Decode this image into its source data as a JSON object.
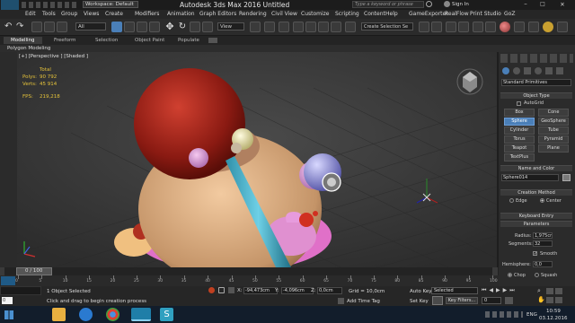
{
  "window": {
    "title": "Autodesk 3ds Max 2016    Untitled",
    "workspace": "Workspace: Default",
    "search_placeholder": "Type a keyword or phrase",
    "sign_in": "Sign In"
  },
  "menu": [
    "Edit",
    "Tools",
    "Group",
    "Views",
    "Create",
    "Modifiers",
    "Animation",
    "Graph Editors",
    "Rendering",
    "Civil View",
    "Customize",
    "Scripting",
    "Content",
    "Help",
    "GameExporter",
    "RealFlow",
    "Print Studio",
    "GoZ"
  ],
  "toolbar": {
    "selection_filter": "All",
    "view_dropdown": "View",
    "named_selection": "Create Selection Se"
  },
  "ribbon": {
    "tabs": [
      "Modelling",
      "Freeform",
      "Selection",
      "Object Paint",
      "Populate"
    ],
    "sub_label": "Polygon Modeling"
  },
  "viewport": {
    "label": "[+] [Perspective ] [Shaded ]",
    "stats": {
      "total_label": "Total",
      "polys_label": "Polys:",
      "polys_value": "90 792",
      "verts_label": "Verts:",
      "verts_value": "45 914",
      "fps_label": "FPS:",
      "fps_value": "219,218"
    }
  },
  "command_panel": {
    "category": "Standard Primitives",
    "object_type_header": "Object Type",
    "autogrid_label": "AutoGrid",
    "buttons": [
      "Box",
      "Cone",
      "Sphere",
      "GeoSphere",
      "Cylinder",
      "Tube",
      "Torus",
      "Pyramid",
      "Teapot",
      "Plane",
      "TextPlus"
    ],
    "active_button": "Sphere",
    "name_color_header": "Name and Color",
    "object_name": "Sphere014",
    "creation_method_header": "Creation Method",
    "edge_label": "Edge",
    "center_label": "Center",
    "keyboard_entry_header": "Keyboard Entry",
    "parameters_header": "Parameters",
    "radius_label": "Radius:",
    "radius_value": "1,975cm",
    "segments_label": "Segments:",
    "segments_value": "32",
    "smooth_label": "Smooth",
    "hemisphere_label": "Hemisphere:",
    "hemisphere_value": "0,0",
    "chop_label": "Chop",
    "squash_label": "Squash",
    "accent_color": "#4a7fb8"
  },
  "timeline": {
    "frame_label": "0 / 100",
    "ticks": [
      "0",
      "5",
      "10",
      "15",
      "20",
      "25",
      "30",
      "35",
      "40",
      "45",
      "50",
      "55",
      "60",
      "65",
      "70",
      "75",
      "80",
      "85",
      "90",
      "95",
      "100"
    ]
  },
  "status": {
    "selected": "1 Object Selected",
    "prompt": "Click and drag to begin creation process",
    "x_label": "X:",
    "x_value": "-94,473cm",
    "y_label": "Y:",
    "y_value": "-4,096cm",
    "z_label": "Z:",
    "z_value": "0,0cm",
    "grid": "Grid = 10,0cm",
    "add_time_tag": "Add Time Tag",
    "auto_key": "Auto Key",
    "set_key": "Set Key",
    "key_mode": "Selected",
    "key_filters": "Key Filters...",
    "frame_field": "0"
  },
  "taskbar": {
    "time": "10:59",
    "date": "03.12.2016",
    "lang": "ENG"
  }
}
